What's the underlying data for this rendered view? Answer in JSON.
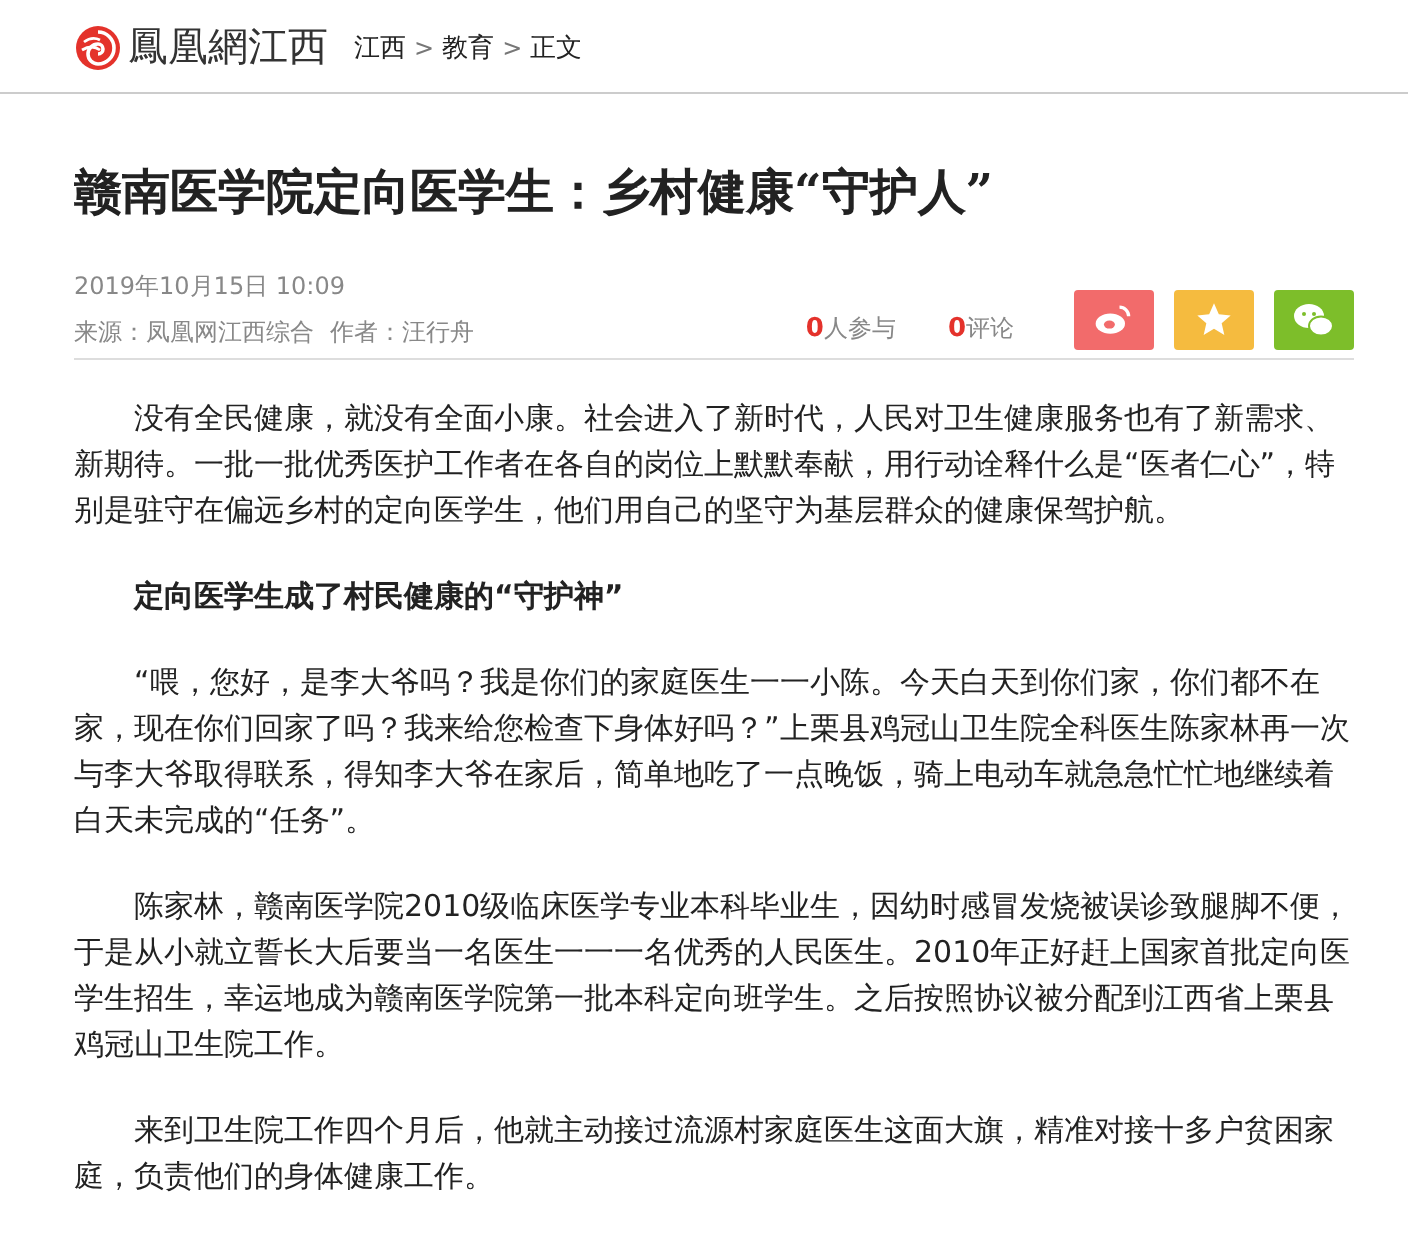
{
  "header": {
    "logo_text": "鳳凰網江西",
    "breadcrumb": [
      {
        "label": "江西"
      },
      {
        "label": "教育"
      },
      {
        "label": "正文"
      }
    ],
    "separator": ">"
  },
  "article": {
    "title": "赣南医学院定向医学生：乡村健康“守护人”",
    "date": "2019年10月15日  10:09",
    "source": "来源：凤凰网江西综合",
    "author": "作者：汪行舟",
    "stats": [
      {
        "count": "0",
        "label": "人参与"
      },
      {
        "count": "0",
        "label": "评论"
      }
    ],
    "share": [
      {
        "kind": "weibo",
        "color": "#f26b6b"
      },
      {
        "kind": "favorite",
        "color": "#f5bb3f"
      },
      {
        "kind": "wechat",
        "color": "#7dbe2a"
      }
    ],
    "body": [
      {
        "kind": "paragraph",
        "text": "没有全民健康，就没有全面小康。社会进入了新时代，人民对卫生健康服务也有了新需求、新期待。一批一批优秀医护工作者在各自的岗位上默默奉献，用行动诠释什么是“医者仁心”，特别是驻守在偏远乡村的定向医学生，他们用自己的坚守为基层群众的健康保驾护航。"
      },
      {
        "kind": "heading",
        "text": "定向医学生成了村民健康的“守护神”"
      },
      {
        "kind": "paragraph",
        "text": "“喂，您好，是李大爷吗？我是你们的家庭医生一一小陈。今天白天到你们家，你们都不在家，现在你们回家了吗？我来给您检查下身体好吗？”上栗县鸡冠山卫生院全科医生陈家林再一次与李大爷取得联系，得知李大爷在家后，简单地吃了一点晚饭，骑上电动车就急急忙忙地继续着白天未完成的“任务”。"
      },
      {
        "kind": "paragraph",
        "text": "陈家林，赣南医学院2010级临床医学专业本科毕业生，因幼时感冒发烧被误诊致腿脚不便，于是从小就立誓长大后要当一名医生一一一名优秀的人民医生。2010年正好赶上国家首批定向医学生招生，幸运地成为赣南医学院第一批本科定向班学生。之后按照协议被分配到江西省上栗县鸡冠山卫生院工作。"
      },
      {
        "kind": "paragraph",
        "text": "来到卫生院工作四个月后，他就主动接过流源村家庭医生这面大旗，精准对接十多户贫困家庭，负责他们的身体健康工作。"
      }
    ]
  }
}
